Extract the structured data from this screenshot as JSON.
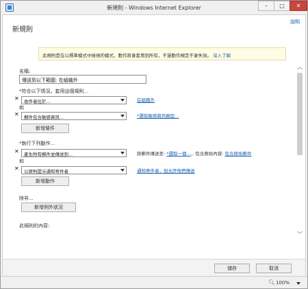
{
  "window": {
    "title": "新規則 - Windows Internet Explorer",
    "min_symbol": "–",
    "max_symbol": "□",
    "close_symbol": "✕"
  },
  "page": {
    "title": "新規則",
    "help": "說明"
  },
  "info_bar": {
    "text": "此規則是在以標準模式中檢視的模式，動作將會套用到所有，不過動作規定不會失效。",
    "link": "深入了解"
  },
  "name": {
    "label": "名稱:",
    "value": "傳送到以下範圍: 在組織外"
  },
  "conditions": {
    "label": "*符合以下情況，套用這個規則...",
    "rows": [
      {
        "remove": "✕",
        "select": "收件者位於...",
        "link": "在組織外"
      },
      {
        "remove": "✕",
        "select": "郵件包含敏感資訊...",
        "link": "*選取敏感資訊類型..."
      }
    ],
    "and_label": "和",
    "add_button": "新增條件"
  },
  "actions": {
    "label": "*執行下列動作...",
    "rows": [
      {
        "remove": "✕",
        "select": "產生附有郵件並傳送到...",
        "link_prefix": "將郵件傳送至: ",
        "link": "*選取一個...",
        "link_suffix": "，包含原始內容: ",
        "link2": "包含原始郵件"
      },
      {
        "remove": "✕",
        "select": "以原則提示通知寄件者",
        "link": "通知寄件者，但允許他們傳送"
      }
    ],
    "and_label": "和",
    "add_button": "新增動作"
  },
  "exceptions": {
    "label": "除非...",
    "add_button": "新增例外狀況"
  },
  "more_options": {
    "label": "此規則的內容:"
  },
  "footer": {
    "save": "儲存",
    "cancel": "取消"
  },
  "status": {
    "zoom": "100%"
  },
  "icons": {
    "app": "ie-window-icon",
    "zoom": "magnifier-icon",
    "scroll_up": "chevron-up-icon",
    "scroll_down": "chevron-down-icon"
  }
}
